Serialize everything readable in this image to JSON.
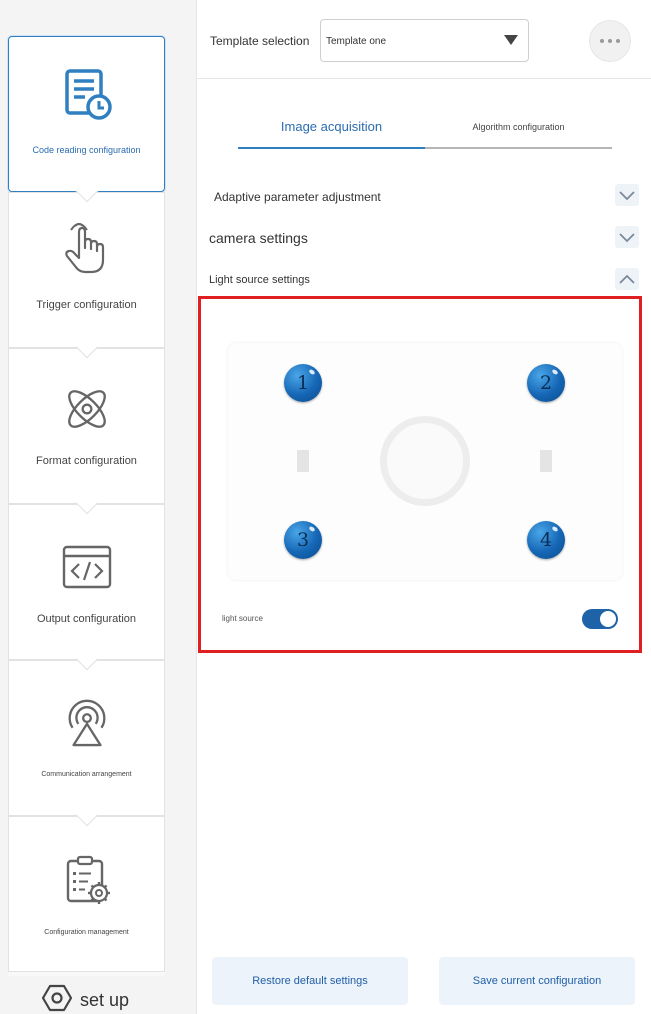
{
  "sidebar": {
    "items": [
      {
        "label": "Code reading configuration",
        "icon": "document-clock-icon",
        "active": true
      },
      {
        "label": "Trigger configuration",
        "icon": "hand-pointer-icon",
        "active": false
      },
      {
        "label": "Format configuration",
        "icon": "atom-icon",
        "active": false
      },
      {
        "label": "Output configuration",
        "icon": "code-window-icon",
        "active": false
      },
      {
        "label": "Communication arrangement",
        "icon": "signal-tower-icon",
        "active": false
      },
      {
        "label": "Configuration management",
        "icon": "clipboard-gear-icon",
        "active": false
      }
    ],
    "setup_label": "set up",
    "setup_icon": "hexagon-settings-icon"
  },
  "header": {
    "template_label": "Template selection",
    "template_value": "Template one",
    "more_icon": "more-dots-icon"
  },
  "tabs": [
    {
      "label": "Image acquisition",
      "active": true
    },
    {
      "label": "Algorithm configuration",
      "active": false
    }
  ],
  "sections": {
    "adaptive": "Adaptive parameter adjustment",
    "camera": "camera settings",
    "light": "Light source settings"
  },
  "light_panel": {
    "leds": [
      "1",
      "2",
      "3",
      "4"
    ],
    "light_source_label": "light source",
    "light_source_on": true
  },
  "buttons": {
    "restore": "Restore default settings",
    "save": "Save current configuration"
  },
  "colors": {
    "accent": "#2f7fc1",
    "highlight": "#e02020",
    "toggle": "#1e63a8",
    "button_bg": "#edf3fa"
  }
}
